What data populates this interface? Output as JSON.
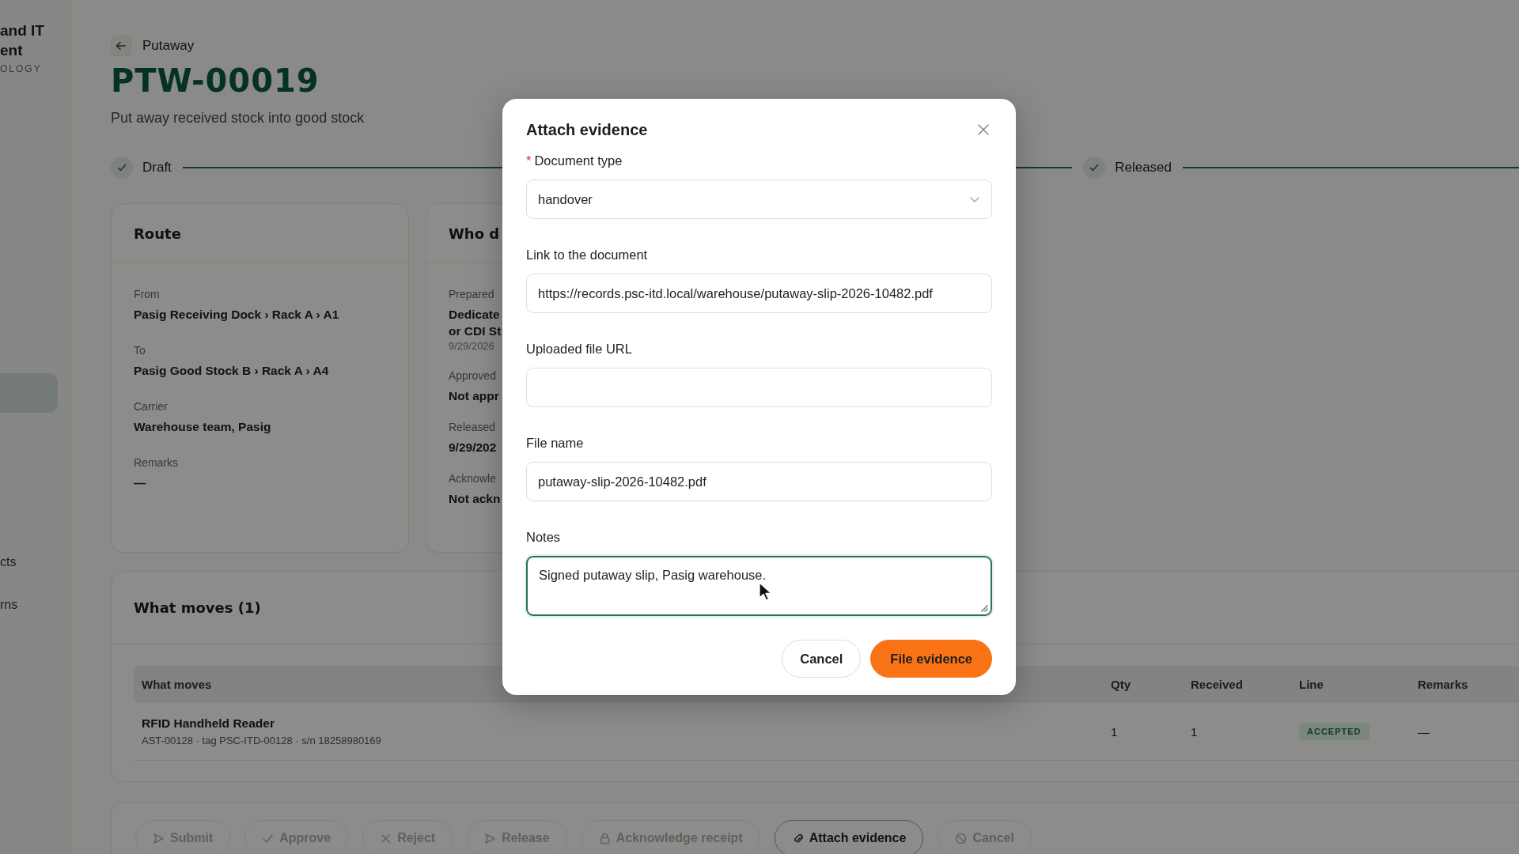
{
  "sidebar": {
    "brand_lines": [
      "and IT",
      "ent"
    ],
    "brand_sub": "OLOGY",
    "items": [
      {
        "selected": true
      },
      {
        "label": "cts",
        "selected": false
      },
      {
        "label": "rns",
        "selected": false
      }
    ]
  },
  "header": {
    "breadcrumb": "Putaway",
    "title": "PTW-00019",
    "subtitle": "Put away received stock into good stock"
  },
  "stepper": [
    {
      "label": "Draft",
      "done": true
    },
    {
      "label": "Released",
      "done": true
    }
  ],
  "route_card": {
    "title": "Route",
    "fields": [
      {
        "label": "From",
        "value": "Pasig Receiving Dock › Rack A › A1"
      },
      {
        "label": "To",
        "value": "Pasig Good Stock B › Rack A › A4"
      },
      {
        "label": "Carrier",
        "value": "Warehouse team, Pasig"
      },
      {
        "label": "Remarks",
        "value": "—"
      }
    ]
  },
  "who_card": {
    "title": "Who d",
    "fields": [
      {
        "label": "Prepared",
        "value_lines": [
          "Dedicate",
          "or CDI St"
        ],
        "date": "9/29/2026"
      },
      {
        "label": "Approved",
        "value_lines": [
          "Not appr"
        ]
      },
      {
        "label": "Released",
        "value_lines": [
          "9/29/202"
        ]
      },
      {
        "label": "Acknowle",
        "value_lines": [
          "Not ackn"
        ]
      }
    ]
  },
  "moves_card": {
    "title": "What moves (1)",
    "columns": [
      "What moves",
      "Qty",
      "Received",
      "Line",
      "Remarks"
    ],
    "rows": [
      {
        "name": "RFID Handheld Reader",
        "detail": "AST-00128 · tag PSC-ITD-00128 · s/n 18258980169",
        "qty": "1",
        "received": "1",
        "line": {
          "label": "ACCEPTED",
          "kind": "accepted"
        },
        "remarks": "—"
      }
    ]
  },
  "actions": [
    {
      "label": "Submit",
      "kind": "send",
      "disabled": true
    },
    {
      "label": "Approve",
      "kind": "check",
      "disabled": true
    },
    {
      "label": "Reject",
      "kind": "cross",
      "disabled": true
    },
    {
      "label": "Release",
      "kind": "send",
      "disabled": true
    },
    {
      "label": "Acknowledge receipt",
      "kind": "lock",
      "disabled": true
    },
    {
      "label": "Attach evidence",
      "kind": "clip",
      "disabled": false
    },
    {
      "label": "Cancel",
      "kind": "ban",
      "disabled": true
    }
  ],
  "modal": {
    "title": "Attach evidence",
    "fields": [
      {
        "kind": "select",
        "label": "Document type",
        "required_mark": "*",
        "value": "handover",
        "focused": false
      },
      {
        "kind": "input",
        "label": "Link to the document",
        "value": "https://records.psc-itd.local/warehouse/putaway-slip-2026-10482.pdf",
        "focused": false
      },
      {
        "kind": "input",
        "label": "Uploaded file URL",
        "focused": false
      },
      {
        "kind": "input",
        "label": "File name",
        "value": "putaway-slip-2026-10482.pdf",
        "focused": false
      },
      {
        "kind": "textarea",
        "label": "Notes",
        "value": "Signed putaway slip, Pasig warehouse.",
        "focused": true
      }
    ],
    "buttons": [
      {
        "label": "Cancel",
        "kind": "secondary"
      },
      {
        "label": "File evidence",
        "kind": "primary"
      }
    ]
  }
}
